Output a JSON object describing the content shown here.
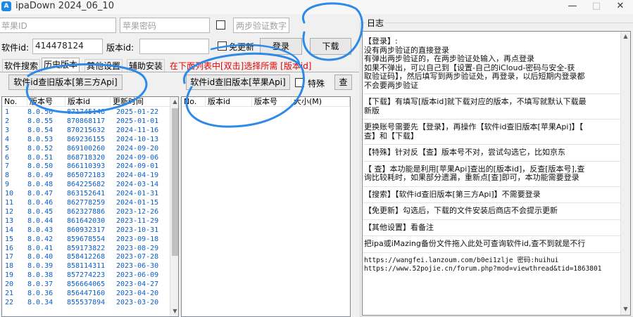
{
  "window": {
    "title": "ipaDown 2024_06_10",
    "app_icon": "A",
    "minimize": "—",
    "maximize": "□",
    "close": "✕"
  },
  "login": {
    "apple_id_placeholder": "苹果ID",
    "apple_pwd_placeholder": "苹果密码",
    "twofa_placeholder": "两步验证数字",
    "login_button": "登录",
    "download_button": "下载"
  },
  "software": {
    "software_id_label": "软件id:",
    "software_id_value": "414478124",
    "version_id_label": "版本id:",
    "version_id_value": "",
    "no_update_label": "免更新"
  },
  "tabs": [
    {
      "label": "软件搜索"
    },
    {
      "label": "历史版本"
    },
    {
      "label": "其他设置"
    },
    {
      "label": "辅助安装"
    }
  ],
  "hint": "在下面列表中[双击]选择所需 [版本id]",
  "left_panel": {
    "query_button": "软件id查旧版本[第三方Api]",
    "columns": [
      "No.",
      "版本号",
      "版本id",
      "更新时间"
    ],
    "rows": [
      [
        "1",
        "8.0.56",
        "871745148",
        "2025-01-22"
      ],
      [
        "2",
        "8.0.55",
        "870868117",
        "2025-01-01"
      ],
      [
        "3",
        "8.0.54",
        "870215632",
        "2024-11-16"
      ],
      [
        "4",
        "8.0.53",
        "869236155",
        "2024-10-13"
      ],
      [
        "5",
        "8.0.52",
        "869100260",
        "2024-09-20"
      ],
      [
        "6",
        "8.0.51",
        "868718320",
        "2024-09-06"
      ],
      [
        "7",
        "8.0.50",
        "866110393",
        "2024-09-01"
      ],
      [
        "8",
        "8.0.49",
        "865072183",
        "2024-04-19"
      ],
      [
        "9",
        "8.0.48",
        "864225682",
        "2024-03-14"
      ],
      [
        "10",
        "8.0.47",
        "863152641",
        "2024-01-31"
      ],
      [
        "11",
        "8.0.46",
        "862778259",
        "2024-01-15"
      ],
      [
        "12",
        "8.0.45",
        "862327886",
        "2023-12-26"
      ],
      [
        "13",
        "8.0.44",
        "861642030",
        "2023-11-29"
      ],
      [
        "14",
        "8.0.43",
        "860932317",
        "2023-10-31"
      ],
      [
        "15",
        "8.0.42",
        "859678554",
        "2023-09-18"
      ],
      [
        "16",
        "8.0.41",
        "859173822",
        "2023-08-29"
      ],
      [
        "17",
        "8.0.40",
        "858412268",
        "2023-07-28"
      ],
      [
        "18",
        "8.0.39",
        "858114311",
        "2023-06-30"
      ],
      [
        "19",
        "8.0.38",
        "857274223",
        "2023-06-09"
      ],
      [
        "20",
        "8.0.37",
        "856664065",
        "2023-04-27"
      ],
      [
        "21",
        "8.0.36",
        "856447160",
        "2023-04-20"
      ],
      [
        "22",
        "8.0.34",
        "855537894",
        "2023-03-20"
      ]
    ]
  },
  "right_panel": {
    "query_button": "软件id查旧版本[苹果Api]",
    "special_label": "特殊",
    "check_button": "查",
    "columns": [
      "No.",
      "版本id",
      "版本号",
      "大小(M)"
    ]
  },
  "log": {
    "legend": "日志",
    "lines": [
      "【登录】:",
      "      没有两步验证的直接登录",
      "      有弹出两步验证的，在两步验证处输入，再点登录",
      "      如果不弹出，可以自己到【设置-自己的iCloud-密码与安全-获",
      "取验证码】，然后填写到两步验证处，再登录，以后短期内登录都",
      "不会要两步验证",
      "",
      "【下载】有填写[版本id]就下载对应的版本，不填写就默认下载最",
      "新版",
      "",
      "更换账号需要先【登录】，再操作【软件id查旧版本[苹果Api]】【",
      "查】和【下载】",
      "",
      "【特殊】针对反【查】版本号不对，尝试勾选它，比如京东",
      "",
      "【 查】本功能是利用[苹果Api]查出的[版本id]，反查[版本号],查",
      "询比较耗时，如果部分遗漏，重新点[查]即可，本功能需要登录",
      "",
      "【搜索】【软件id查旧版本[第三方Api]】不需要登录",
      "",
      "【免更新】勾选后，下载的文件安装后商店不会提示更新",
      "",
      "【其他设置】看备注",
      "",
      "把ipa或iMazing备份文件拖入此处可查询软件id,查不到就是不行",
      "",
      "https://wangfei.lanzoum.com/b0ei1zlje 密码:huihui",
      "https://www.52pojie.cn/forum.php?mod=viewthread&tid=1863801"
    ]
  },
  "colors": {
    "list_text": "#0a5ec7",
    "hint_red": "#e60000",
    "annotation_blue": "#2e8ae6",
    "app_icon": "#1e88e5"
  }
}
